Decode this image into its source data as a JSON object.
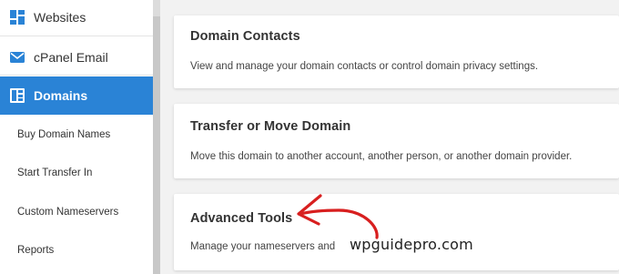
{
  "sidebar": {
    "items": [
      {
        "label": "Websites",
        "icon": "websites-icon"
      },
      {
        "label": "cPanel Email",
        "icon": "email-icon"
      },
      {
        "label": "Domains",
        "icon": "domains-icon",
        "active": true
      }
    ],
    "subitems": [
      {
        "label": "Buy Domain Names"
      },
      {
        "label": "Start Transfer In"
      },
      {
        "label": "Custom Nameservers"
      },
      {
        "label": "Reports"
      }
    ],
    "accent_color": "#2a83d6"
  },
  "cards": [
    {
      "title": "Domain Contacts",
      "description": "View and manage your domain contacts or control domain privacy settings."
    },
    {
      "title": "Transfer or Move Domain",
      "description": "Move this domain to another account, another person, or another domain provider."
    },
    {
      "title": "Advanced Tools",
      "description": "Manage your nameservers and"
    }
  ],
  "watermark": "wpguidepro.com",
  "annotation": {
    "arrow_color": "#d81f1f"
  }
}
